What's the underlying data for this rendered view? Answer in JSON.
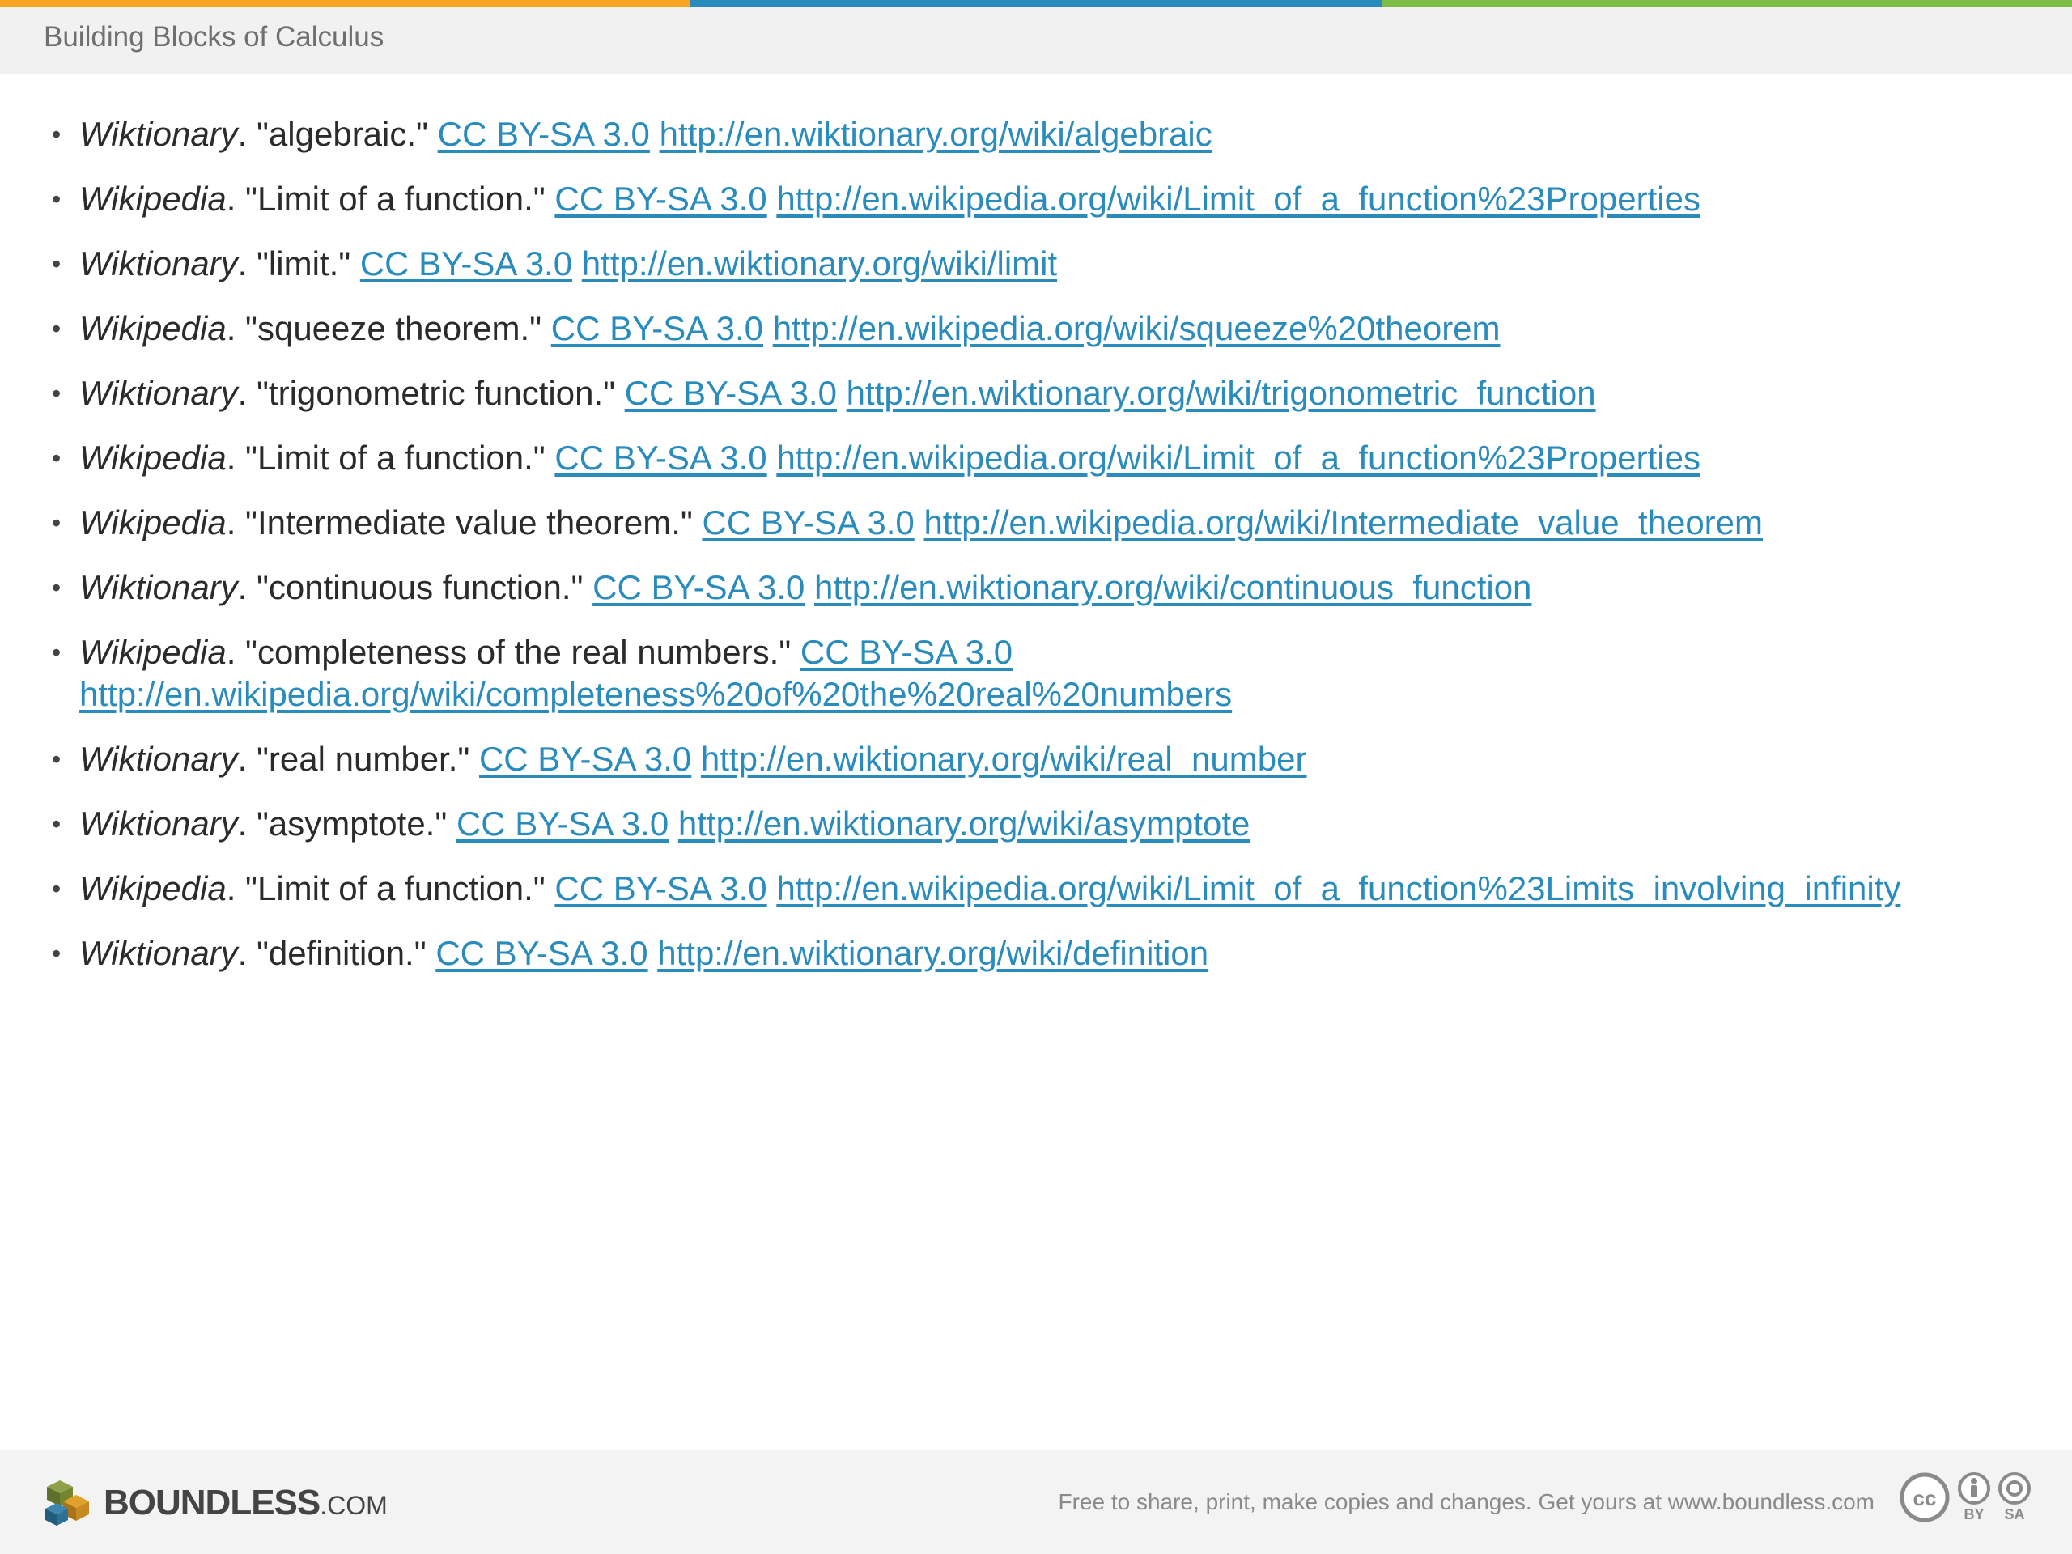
{
  "colors": {
    "bar1": "#f8a624",
    "bar2": "#2a8bbd",
    "bar3": "#7bbd45",
    "link": "#2a8bbd"
  },
  "header": {
    "title": "Building Blocks of Calculus"
  },
  "references": [
    {
      "source": "Wiktionary",
      "term": "\"algebraic.\"",
      "license": "CC BY-SA 3.0",
      "url": "http://en.wiktionary.org/wiki/algebraic"
    },
    {
      "source": "Wikipedia",
      "term": "\"Limit of a function.\"",
      "license": "CC BY-SA 3.0",
      "url": "http://en.wikipedia.org/wiki/Limit_of_a_function%23Properties"
    },
    {
      "source": "Wiktionary",
      "term": "\"limit.\"",
      "license": "CC BY-SA 3.0",
      "url": "http://en.wiktionary.org/wiki/limit"
    },
    {
      "source": "Wikipedia",
      "term": "\"squeeze theorem.\"",
      "license": "CC BY-SA 3.0",
      "url": "http://en.wikipedia.org/wiki/squeeze%20theorem"
    },
    {
      "source": "Wiktionary",
      "term": "\"trigonometric function.\"",
      "license": "CC BY-SA 3.0",
      "url": "http://en.wiktionary.org/wiki/trigonometric_function"
    },
    {
      "source": "Wikipedia",
      "term": "\"Limit of a function.\"",
      "license": "CC BY-SA 3.0",
      "url": "http://en.wikipedia.org/wiki/Limit_of_a_function%23Properties"
    },
    {
      "source": "Wikipedia",
      "term": "\"Intermediate value theorem.\"",
      "license": "CC BY-SA 3.0",
      "url": "http://en.wikipedia.org/wiki/Intermediate_value_theorem"
    },
    {
      "source": "Wiktionary",
      "term": "\"continuous function.\"",
      "license": "CC BY-SA 3.0",
      "url": "http://en.wiktionary.org/wiki/continuous_function"
    },
    {
      "source": "Wikipedia",
      "term": "\"completeness of the real numbers.\"",
      "license": "CC BY-SA 3.0",
      "url": "http://en.wikipedia.org/wiki/completeness%20of%20the%20real%20numbers"
    },
    {
      "source": "Wiktionary",
      "term": "\"real number.\"",
      "license": "CC BY-SA 3.0",
      "url": "http://en.wiktionary.org/wiki/real_number"
    },
    {
      "source": "Wiktionary",
      "term": "\"asymptote.\"",
      "license": "CC BY-SA 3.0",
      "url": "http://en.wiktionary.org/wiki/asymptote"
    },
    {
      "source": "Wikipedia",
      "term": "\"Limit of a function.\"",
      "license": "CC BY-SA 3.0",
      "url": "http://en.wikipedia.org/wiki/Limit_of_a_function%23Limits_involving_infinity"
    },
    {
      "source": "Wiktionary",
      "term": "\"definition.\"",
      "license": "CC BY-SA 3.0",
      "url": "http://en.wiktionary.org/wiki/definition"
    }
  ],
  "footer": {
    "brand": "BOUNDLESS",
    "brand_suffix": ".COM",
    "share_text": "Free to share, print, make copies and changes. Get yours at www.boundless.com",
    "cc": {
      "by_label": "BY",
      "sa_label": "SA"
    }
  }
}
